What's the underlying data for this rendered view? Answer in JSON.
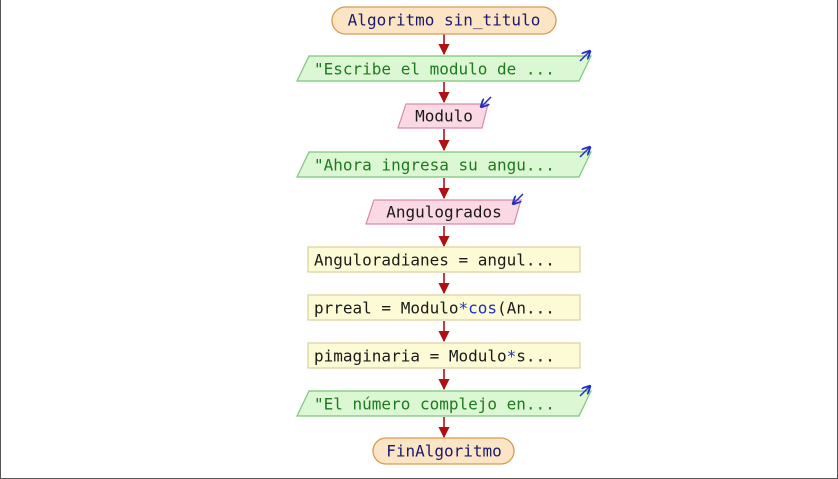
{
  "flowchart": {
    "start": {
      "label": "Algoritmo sin_titulo"
    },
    "steps": [
      {
        "kind": "output",
        "label": "\"Escribe el modulo de ...",
        "icon": "output-arrow-icon"
      },
      {
        "kind": "input",
        "label": "Modulo",
        "icon": "input-arrow-icon"
      },
      {
        "kind": "output",
        "label": "\"Ahora ingresa su angu...",
        "icon": "output-arrow-icon"
      },
      {
        "kind": "input",
        "label": "Angulogrados",
        "icon": "input-arrow-icon"
      },
      {
        "kind": "process",
        "label": "Anguloradianes = angul..."
      },
      {
        "kind": "process",
        "label_pre": "prreal = Modulo",
        "label_op": "*",
        "label_fn": "cos",
        "label_post": "(An..."
      },
      {
        "kind": "process",
        "label_pre": "pimaginaria = Modulo",
        "label_op": "*",
        "label_post": "s..."
      },
      {
        "kind": "output",
        "label": "\"El número complejo en...",
        "icon": "output-arrow-icon"
      }
    ],
    "end": {
      "label": "FinAlgoritmo"
    }
  },
  "colors": {
    "terminal_fill": "#fbe5c5",
    "terminal_stroke": "#d99a50",
    "output_fill": "#dcf7d4",
    "output_stroke": "#7cc67a",
    "input_fill": "#fbd9e4",
    "input_stroke": "#d98aa6",
    "process_fill": "#fdfbd6",
    "process_stroke": "#d8d39a",
    "arrow": "#b01010"
  }
}
